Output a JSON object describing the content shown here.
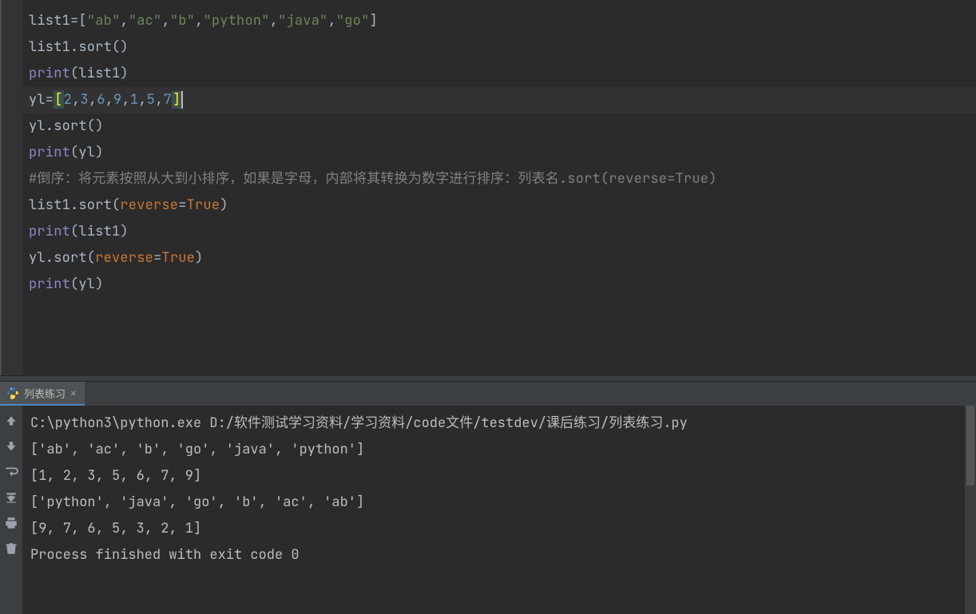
{
  "editor": {
    "lines": [
      {
        "tokens": [
          {
            "t": "list1=",
            "c": "id"
          },
          {
            "t": "[",
            "c": "br"
          },
          {
            "t": "\"ab\"",
            "c": "str"
          },
          {
            "t": ",",
            "c": "id"
          },
          {
            "t": "\"ac\"",
            "c": "str"
          },
          {
            "t": ",",
            "c": "id"
          },
          {
            "t": "\"b\"",
            "c": "str"
          },
          {
            "t": ",",
            "c": "id"
          },
          {
            "t": "\"python\"",
            "c": "str"
          },
          {
            "t": ",",
            "c": "id"
          },
          {
            "t": "\"java\"",
            "c": "str"
          },
          {
            "t": ",",
            "c": "id"
          },
          {
            "t": "\"go\"",
            "c": "str"
          },
          {
            "t": "]",
            "c": "br"
          }
        ]
      },
      {
        "tokens": [
          {
            "t": "list1.sort()",
            "c": "id"
          }
        ]
      },
      {
        "tokens": [
          {
            "t": "print",
            "c": "fn"
          },
          {
            "t": "(list1)",
            "c": "id"
          }
        ]
      },
      {
        "cursor": true,
        "tokens": [
          {
            "t": "yl=",
            "c": "id"
          },
          {
            "t": "[",
            "c": "br-match"
          },
          {
            "t": "2",
            "c": "num"
          },
          {
            "t": ",",
            "c": "id"
          },
          {
            "t": "3",
            "c": "num"
          },
          {
            "t": ",",
            "c": "id"
          },
          {
            "t": "6",
            "c": "num"
          },
          {
            "t": ",",
            "c": "id"
          },
          {
            "t": "9",
            "c": "num"
          },
          {
            "t": ",",
            "c": "id"
          },
          {
            "t": "1",
            "c": "num"
          },
          {
            "t": ",",
            "c": "id"
          },
          {
            "t": "5",
            "c": "num"
          },
          {
            "t": ",",
            "c": "id"
          },
          {
            "t": "7",
            "c": "num"
          },
          {
            "t": "]",
            "c": "br-match"
          }
        ]
      },
      {
        "tokens": [
          {
            "t": "yl.sort()",
            "c": "id"
          }
        ]
      },
      {
        "tokens": [
          {
            "t": "print",
            "c": "fn"
          },
          {
            "t": "(yl)",
            "c": "id"
          }
        ]
      },
      {
        "tokens": [
          {
            "t": "#倒序：将元素按照从大到小排序，如果是字母，内部将其转换为数字进行排序：列表名.sort(reverse=True)",
            "c": "cmt"
          }
        ]
      },
      {
        "tokens": [
          {
            "t": "list1.sort(",
            "c": "id"
          },
          {
            "t": "reverse",
            "c": "kw"
          },
          {
            "t": "=",
            "c": "id"
          },
          {
            "t": "True",
            "c": "kw"
          },
          {
            "t": ")",
            "c": "id"
          }
        ]
      },
      {
        "tokens": [
          {
            "t": "print",
            "c": "fn"
          },
          {
            "t": "(list1)",
            "c": "id"
          }
        ]
      },
      {
        "tokens": [
          {
            "t": "yl.sort(",
            "c": "id"
          },
          {
            "t": "reverse",
            "c": "kw"
          },
          {
            "t": "=",
            "c": "id"
          },
          {
            "t": "True",
            "c": "kw"
          },
          {
            "t": ")",
            "c": "id"
          }
        ]
      },
      {
        "tokens": [
          {
            "t": "print",
            "c": "fn"
          },
          {
            "t": "(yl)",
            "c": "id"
          }
        ]
      }
    ]
  },
  "run_tab": {
    "label": "列表练习",
    "close": "×"
  },
  "console": {
    "lines": [
      "C:\\python3\\python.exe D:/软件测试学习资料/学习资料/code文件/testdev/课后练习/列表练习.py",
      "['ab', 'ac', 'b', 'go', 'java', 'python']",
      "[1, 2, 3, 5, 6, 7, 9]",
      "['python', 'java', 'go', 'b', 'ac', 'ab']",
      "[9, 7, 6, 5, 3, 2, 1]",
      "",
      "Process finished with exit code 0"
    ]
  },
  "toolstrip": {
    "buttons": [
      {
        "name": "arrow-up-icon"
      },
      {
        "name": "arrow-down-icon"
      },
      {
        "name": "soft-wrap-icon"
      },
      {
        "name": "scroll-to-end-icon"
      },
      {
        "name": "print-icon"
      },
      {
        "name": "trash-icon"
      }
    ]
  }
}
